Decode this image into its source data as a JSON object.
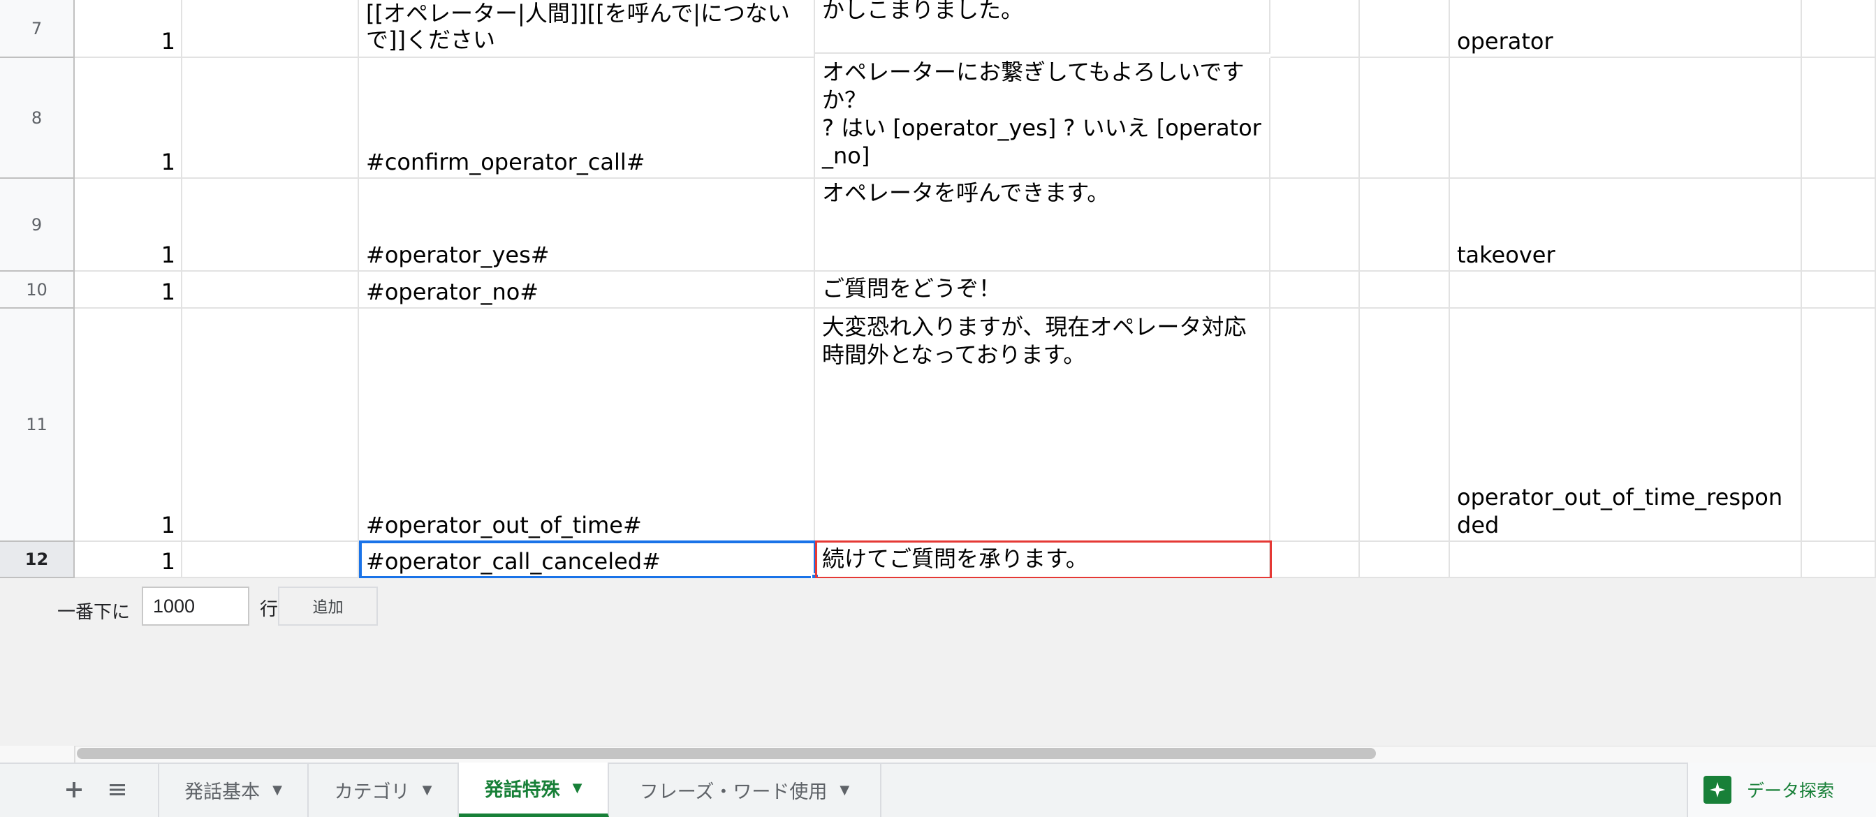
{
  "rows": [
    {
      "num": "7",
      "col_a": "1",
      "col_c": "[[オペレーター|人間]][[を呼んで|につないで]]ください",
      "col_d": "かしこまりました。",
      "col_g": "operator"
    },
    {
      "num": "8",
      "col_a": "1",
      "col_c": "#confirm_operator_call#",
      "col_d": "オペレーターにお繋ぎしてもよろしいですか？\n? はい [operator_yes] ? いいえ [operator_no]",
      "col_g": ""
    },
    {
      "num": "9",
      "col_a": "1",
      "col_c": "#operator_yes#",
      "col_d": "オペレータを呼んできます。",
      "col_g": "takeover"
    },
    {
      "num": "10",
      "col_a": "1",
      "col_c": "#operator_no#",
      "col_d": "ご質問をどうぞ！",
      "col_g": ""
    },
    {
      "num": "11",
      "col_a": "1",
      "col_c": "#operator_out_of_time#",
      "col_d": "大変恐れ入りますが、現在オペレータ対応時間外となっております。",
      "col_g": "operator_out_of_time_responded"
    },
    {
      "num": "12",
      "col_a": "1",
      "col_c": "#operator_call_canceled#",
      "col_d": "続けてご質問を承ります。",
      "col_g": ""
    }
  ],
  "add_rows": {
    "prefix": "一番下に",
    "value": "1000",
    "suffix": "行",
    "button": "追加"
  },
  "sheet_tabs": [
    {
      "label": "発話基本",
      "active": false
    },
    {
      "label": "カテゴリ",
      "active": false
    },
    {
      "label": "発話特殊",
      "active": true
    },
    {
      "label": "フレーズ・ワード使用",
      "active": false
    }
  ],
  "toolbar": {
    "add_sheet_icon": "plus-icon",
    "all_sheets_icon": "list-icon"
  },
  "explore": {
    "label": "データ探索",
    "icon": "explore-sparkle-icon"
  },
  "colors": {
    "selection": "#1a73e8",
    "highlight_red": "#e53935",
    "active_tab": "#188038"
  }
}
